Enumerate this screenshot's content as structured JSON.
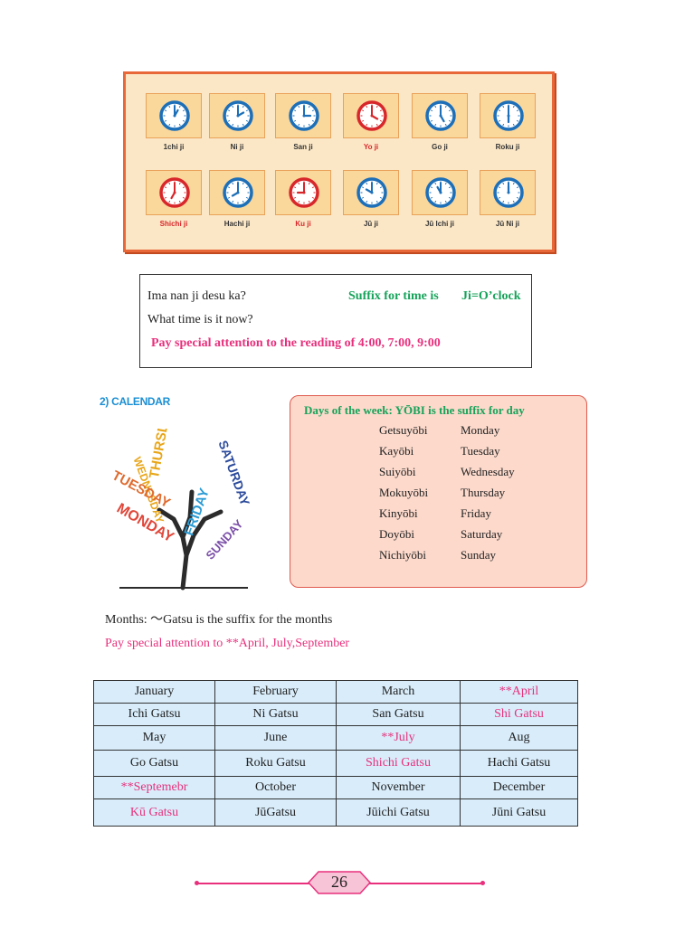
{
  "clocks": {
    "row1": [
      {
        "label": "1chi ji",
        "hour": 1,
        "color": "#1c6fb8"
      },
      {
        "label": "Ni ji",
        "hour": 2,
        "color": "#1c6fb8"
      },
      {
        "label": "San ji",
        "hour": 3,
        "color": "#1c6fb8"
      },
      {
        "label": "Yo ji",
        "hour": 4,
        "color": "#d8272b"
      },
      {
        "label": "Go ji",
        "hour": 5,
        "color": "#1c6fb8"
      },
      {
        "label": "Roku ji",
        "hour": 6,
        "color": "#1c6fb8"
      }
    ],
    "row2": [
      {
        "label": "Shichi ji",
        "hour": 7,
        "color": "#d8272b"
      },
      {
        "label": "Hachi ji",
        "hour": 8,
        "color": "#1c6fb8"
      },
      {
        "label": "Ku ji",
        "hour": 9,
        "color": "#d8272b"
      },
      {
        "label": "Jū ji",
        "hour": 10,
        "color": "#1c6fb8"
      },
      {
        "label": "Jū Ichi ji",
        "hour": 11,
        "color": "#1c6fb8"
      },
      {
        "label": "Jū Ni ji",
        "hour": 12,
        "color": "#1c6fb8"
      }
    ]
  },
  "info": {
    "question_jp": "Ima nan ji desu ka?",
    "suffix_note": "Suffix for time is",
    "ji_def": "Ji=O’clock",
    "question_en": "What time is it now?",
    "attention": "Pay special attention to the reading of  4:00, 7:00, 9:00"
  },
  "calendar": {
    "heading": "2) CALENDAR",
    "tree_words": [
      "WEDNESDAY",
      "THURSDAY",
      "TUESDAY",
      "MONDAY",
      "FRIDAY",
      "SATURDAY",
      "SUNDAY"
    ]
  },
  "days": {
    "title": "Days of the week:  YŌBI is the suffix for day",
    "rows": [
      {
        "jp": "Getsuyōbi",
        "en": "Monday"
      },
      {
        "jp": "Kayōbi",
        "en": "Tuesday"
      },
      {
        "jp": "Suiyōbi",
        "en": "Wednesday"
      },
      {
        "jp": "Mokuyōbi",
        "en": "Thursday"
      },
      {
        "jp": "Kinyōbi",
        "en": "Friday"
      },
      {
        "jp": "Doyōbi",
        "en": "Saturday"
      },
      {
        "jp": "Nichiyōbi",
        "en": "Sunday"
      }
    ]
  },
  "months": {
    "suffix_line": "Months:  ～Gatsu is the suffix for the months",
    "attention": "Pay special attention to **April, July,September",
    "table": [
      [
        "January",
        "February",
        "March",
        "**April"
      ],
      [
        "Ichi Gatsu",
        "Ni Gatsu",
        "San Gatsu",
        "Shi Gatsu"
      ],
      [
        "May",
        "June",
        "**July",
        "Aug"
      ],
      [
        "Go Gatsu",
        "Roku Gatsu",
        "Shichi Gatsu",
        "Hachi Gatsu"
      ],
      [
        "**Septemebr",
        "October",
        "November",
        "December"
      ],
      [
        "Kū Gatsu",
        "JūGatsu",
        "Jūichi Gatsu",
        "Jūni Gatsu"
      ]
    ],
    "highlight_color": "#e8307c"
  },
  "footer": {
    "page_number": "26"
  }
}
